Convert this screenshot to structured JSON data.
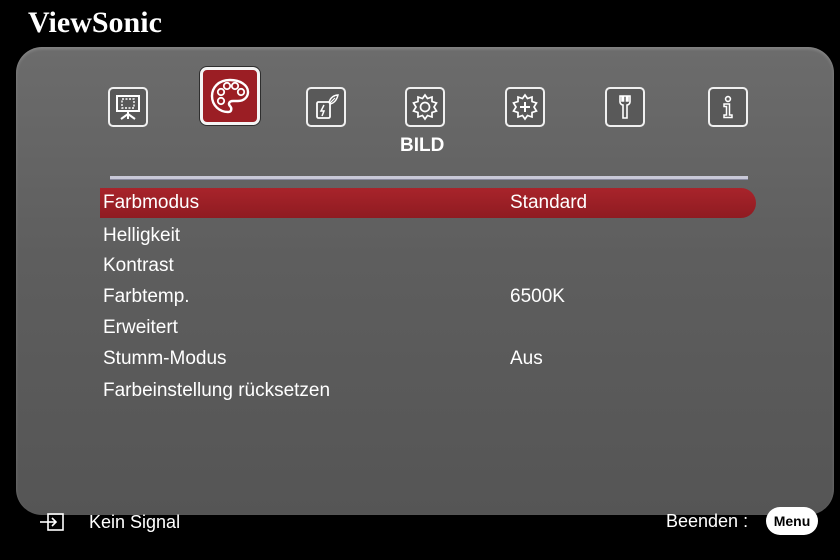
{
  "brand": "ViewSonic",
  "tabs": [
    {
      "name": "display-icon",
      "active": false
    },
    {
      "name": "palette-icon",
      "active": true
    },
    {
      "name": "power-eco-icon",
      "active": false
    },
    {
      "name": "basic-gear-icon",
      "active": false
    },
    {
      "name": "advanced-gear-icon",
      "active": false
    },
    {
      "name": "system-wrench-icon",
      "active": false
    },
    {
      "name": "info-icon",
      "active": false
    }
  ],
  "active_tab_title": "BILD",
  "menu": {
    "items": [
      {
        "label": "Farbmodus",
        "value": "Standard",
        "selected": true
      },
      {
        "label": "Helligkeit",
        "value": ""
      },
      {
        "label": "Kontrast",
        "value": ""
      },
      {
        "label": "Farbtemp.",
        "value": "6500K"
      },
      {
        "label": "Erweitert",
        "value": ""
      },
      {
        "label": "Stumm-Modus",
        "value": "Aus"
      },
      {
        "label": "Farbeinstellung rücksetzen",
        "value": ""
      }
    ]
  },
  "footer": {
    "input_icon": "input-source-icon",
    "signal_status": "Kein Signal",
    "exit_label": "Beenden :",
    "menu_key": "Menu"
  },
  "colors": {
    "accent": "#9b1e24",
    "panel": "#5e5e5e",
    "background": "#000000",
    "text": "#ffffff"
  }
}
